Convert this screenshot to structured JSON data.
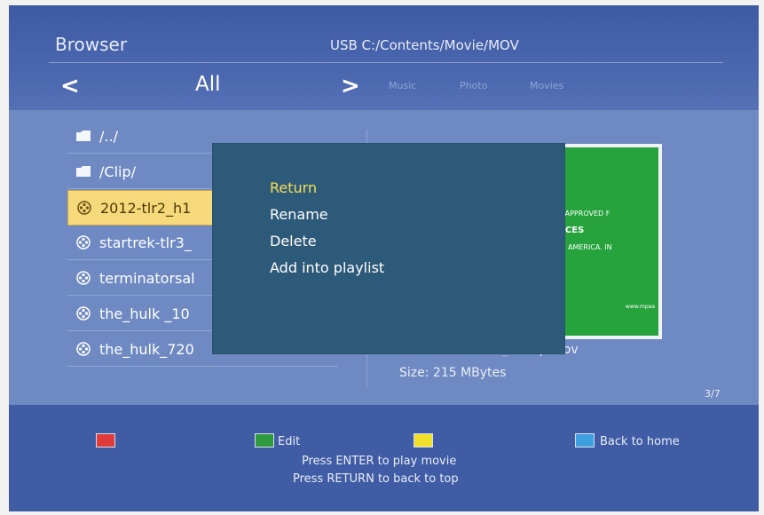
{
  "header": {
    "title": "Browser",
    "path": "USB C:/Contents/Movie/MOV"
  },
  "nav": {
    "prev_glyph": "<",
    "current": "All",
    "next_glyph": ">",
    "tabs": [
      "Music",
      "Photo",
      "Movies"
    ]
  },
  "files": [
    {
      "name": "/../",
      "icon": "folder-icon"
    },
    {
      "name": "/Clip/",
      "icon": "folder-icon"
    },
    {
      "name": "2012-tlr2_h1",
      "icon": "movie-reel-icon",
      "selected": true
    },
    {
      "name": "startrek-tlr3_",
      "icon": "movie-reel-icon"
    },
    {
      "name": "terminatorsal",
      "icon": "movie-reel-icon"
    },
    {
      "name": "the_hulk _10",
      "icon": "movie-reel-icon"
    },
    {
      "name": "the_hulk_720",
      "icon": "movie-reel-icon"
    }
  ],
  "context_menu": {
    "items": [
      "Return",
      "Rename",
      "Delete",
      "Add into playlist"
    ],
    "active_index": 0
  },
  "preview": {
    "poster_lines": [
      "EEN APPROVED F",
      "IENCES",
      "N OF AMERICA. IN",
      "www.mpaa"
    ],
    "name_partial": "p.mov",
    "size": "Size: 215 MBytes"
  },
  "page_count": "3/7",
  "footer": {
    "buttons": [
      {
        "color": "#e03a3a",
        "label": ""
      },
      {
        "color": "#2e9a3e",
        "label": "Edit"
      },
      {
        "color": "#f0e02a",
        "label": ""
      },
      {
        "color": "#3ea0dc",
        "label": "Back to home"
      }
    ],
    "hint1": "Press ENTER to play movie",
    "hint2": "Press RETURN to back to top"
  }
}
